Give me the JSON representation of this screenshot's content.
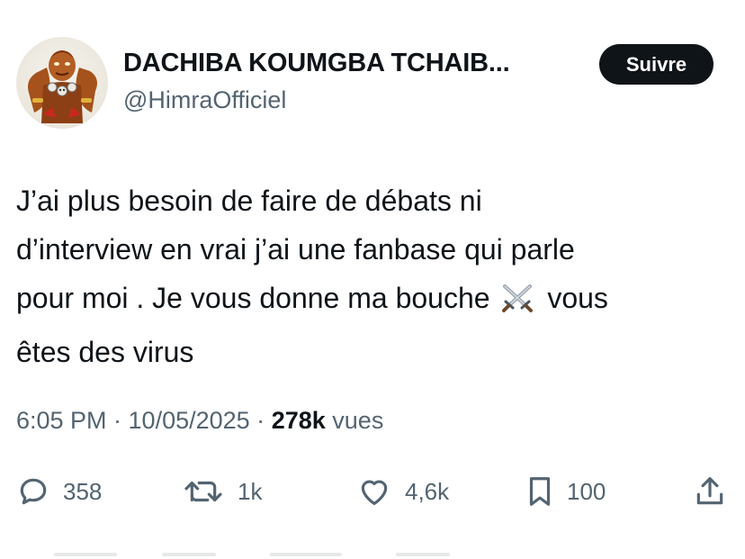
{
  "tweet": {
    "author": {
      "display_name": "DACHIBA KOUMGBA TCHAIB...",
      "handle": "@HimraOfficiel"
    },
    "follow_label": "Suivre",
    "text": {
      "line1": "J’ai plus besoin de faire de débats ni",
      "line2": "d’interview en vrai j’ai une fanbase qui parle",
      "line3_before": "pour moi . Je vous donne ma bouche",
      "line3_after": "vous",
      "line4": "êtes des virus",
      "emoji_icon": "crossed-swords-icon"
    },
    "timestamp": "6:05 PM · 10/05/2025 ·",
    "views_count": "278k",
    "views_label": "vues",
    "stats": {
      "replies": "358",
      "reposts": "1k",
      "likes": "4,6k",
      "bookmarks": "100"
    }
  },
  "colors": {
    "text_primary": "#0f1419",
    "text_secondary": "#536471",
    "button_bg": "#0f1419",
    "button_text": "#ffffff"
  }
}
